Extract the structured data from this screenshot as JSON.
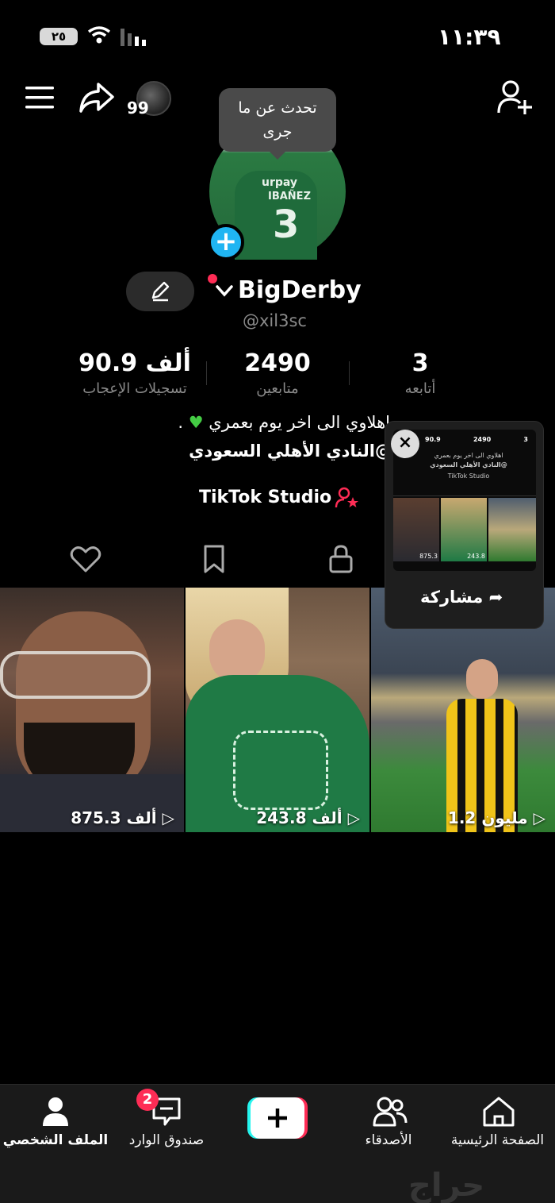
{
  "status_bar": {
    "time": "١١:٣٩",
    "battery": "٢٥"
  },
  "top_bar": {
    "story_count": "99"
  },
  "tooltip": {
    "line1": "تحدث عن ما",
    "line2": "جرى"
  },
  "avatar_photo": {
    "jersey_sponsor": "urpay",
    "jersey_name": "IBAÑEZ",
    "jersey_number": "3"
  },
  "profile": {
    "username": "BigDerby",
    "handle": "@xil3sc"
  },
  "stats": [
    {
      "value": "90.9 ألف",
      "label": "تسجيلات الإعجاب"
    },
    {
      "value": "2490",
      "label": "متابعين"
    },
    {
      "value": "3",
      "label": "أتابعه"
    }
  ],
  "bio": {
    "line1": "اهلاوي الى اخر يوم بعمري",
    "line1_end": ".",
    "line2": "@النادي الأهلي السعودي"
  },
  "studio_label": "TikTok Studio",
  "videos": [
    {
      "views": "875.3 ألف"
    },
    {
      "views": "243.8 ألف"
    },
    {
      "views": "1.2 مليون"
    }
  ],
  "share_popup": {
    "close": "×",
    "label": "مشاركة",
    "mini_stats": [
      "90.9",
      "2490",
      "3"
    ],
    "mini_bio": "اهلاوي الى اخر يوم بعمري",
    "mini_bio2": "@النادي الأهلي السعودي",
    "mini_studio": "TikTok Studio",
    "mini_views": [
      "875.3",
      "243.8"
    ]
  },
  "bottom_nav": {
    "profile": "الملف الشخصي",
    "inbox": "صندوق الوارد",
    "inbox_badge": "2",
    "friends": "الأصدقاء",
    "home": "الصفحة الرئيسية"
  },
  "watermark": "حراج",
  "colors": {
    "accent_red": "#fe2c55",
    "accent_cyan": "#25f4ee",
    "avatar_plus": "#20b5f2"
  }
}
